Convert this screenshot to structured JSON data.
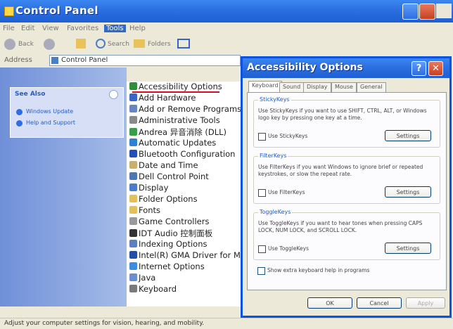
{
  "window": {
    "title": "Control Panel"
  },
  "menu": [
    "File",
    "Edit",
    "View",
    "Favorites",
    "Tools",
    "Help"
  ],
  "toolbar": {
    "back_label": "Back",
    "search_label": "Search",
    "folders_label": "Folders"
  },
  "address": {
    "label": "Address",
    "value": "Control Panel"
  },
  "sidebar": {
    "see_also_title": "See Also",
    "items": [
      "Windows Update",
      "Help and Support"
    ]
  },
  "items": [
    "Accessibility Options",
    "Add Hardware",
    "Add or Remove Programs",
    "Administrative Tools",
    "Andrea 异音消除 (DLL)",
    "Automatic Updates",
    "Bluetooth Configuration",
    "Date and Time",
    "Dell Control Point",
    "Display",
    "Folder Options",
    "Fonts",
    "Game Controllers",
    "IDT Audio 控制面板",
    "Indexing Options",
    "Intel(R) GMA Driver for M",
    "Internet Options",
    "Java",
    "Keyboard"
  ],
  "status": {
    "text": "Adjust your computer settings for vision, hearing, and mobility."
  },
  "dialog": {
    "title": "Accessibility Options",
    "help_glyph": "?",
    "close_glyph": "✕",
    "tabs": [
      "Keyboard",
      "Sound",
      "Display",
      "Mouse",
      "General"
    ],
    "sticky": {
      "title": "StickyKeys",
      "desc": "Use StickyKeys if you want to use SHIFT, CTRL, ALT, or Windows logo key by pressing one key at a time.",
      "checkbox": "Use StickyKeys",
      "button": "Settings"
    },
    "filter": {
      "title": "FilterKeys",
      "desc": "Use FilterKeys if you want Windows to ignore brief or repeated keystrokes, or slow the repeat rate.",
      "checkbox": "Use FilterKeys",
      "button": "Settings"
    },
    "toggle": {
      "title": "ToggleKeys",
      "desc": "Use ToggleKeys if you want to hear tones when pressing CAPS LOCK, NUM LOCK, and SCROLL LOCK.",
      "checkbox": "Use ToggleKeys",
      "button": "Settings"
    },
    "extra_checkbox": "Show extra keyboard help in programs",
    "ok_label": "OK",
    "cancel_label": "Cancel",
    "apply_label": "Apply"
  },
  "colors": {
    "titlebar": "#2b6fe0",
    "highlight_line": "#d0102a"
  }
}
